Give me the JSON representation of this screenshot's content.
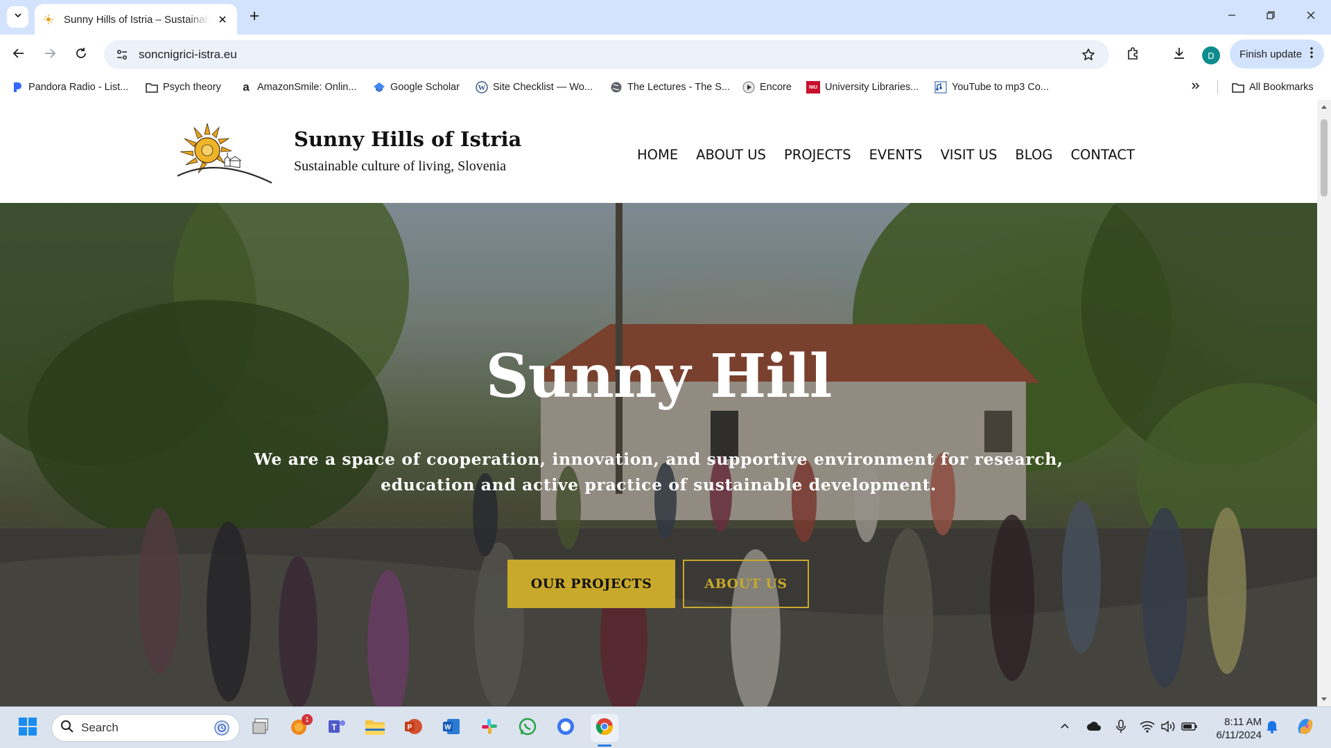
{
  "browser": {
    "tab": {
      "title": "Sunny Hills of Istria – Sustainable culture of living, Slovenia",
      "close": "✕"
    },
    "new_tab": "+",
    "url": "soncnigrici-istra.eu",
    "profile_initial": "D",
    "finish_update_label": "Finish update",
    "bookmarks": [
      {
        "label": "Pandora Radio - List...",
        "icon": "pandora-icon"
      },
      {
        "label": "Psych theory",
        "icon": "folder-icon"
      },
      {
        "label": "AmazonSmile: Onlin...",
        "icon": "amazon-icon"
      },
      {
        "label": "Google Scholar",
        "icon": "scholar-icon"
      },
      {
        "label": "Site Checklist — Wo...",
        "icon": "wordpress-icon"
      },
      {
        "label": "The Lectures - The S...",
        "icon": "globe-icon"
      },
      {
        "label": "Encore",
        "icon": "play-icon"
      },
      {
        "label": "University Libraries...",
        "icon": "niu-icon"
      },
      {
        "label": "YouTube to mp3 Co...",
        "icon": "mp3-icon"
      }
    ],
    "all_bookmarks_label": "All Bookmarks",
    "niu_badge": "NIU"
  },
  "site": {
    "title": "Sunny Hills of Istria",
    "tagline": "Sustainable culture of living, Slovenia",
    "nav": [
      "HOME",
      "ABOUT US",
      "PROJECTS",
      "EVENTS",
      "VISIT US",
      "BLOG",
      "CONTACT"
    ],
    "hero": {
      "heading": "Sunny Hill",
      "text": "We are a space of cooperation, innovation, and supportive environment for research, education and active practice of sustainable development.",
      "primary_button": "OUR PROJECTS",
      "secondary_button": "ABOUT US"
    },
    "colors": {
      "accent": "#c9a92c"
    }
  },
  "taskbar": {
    "search_label": "Search",
    "notification_badge": "1",
    "time": "8:11 AM",
    "date": "6/11/2024"
  }
}
